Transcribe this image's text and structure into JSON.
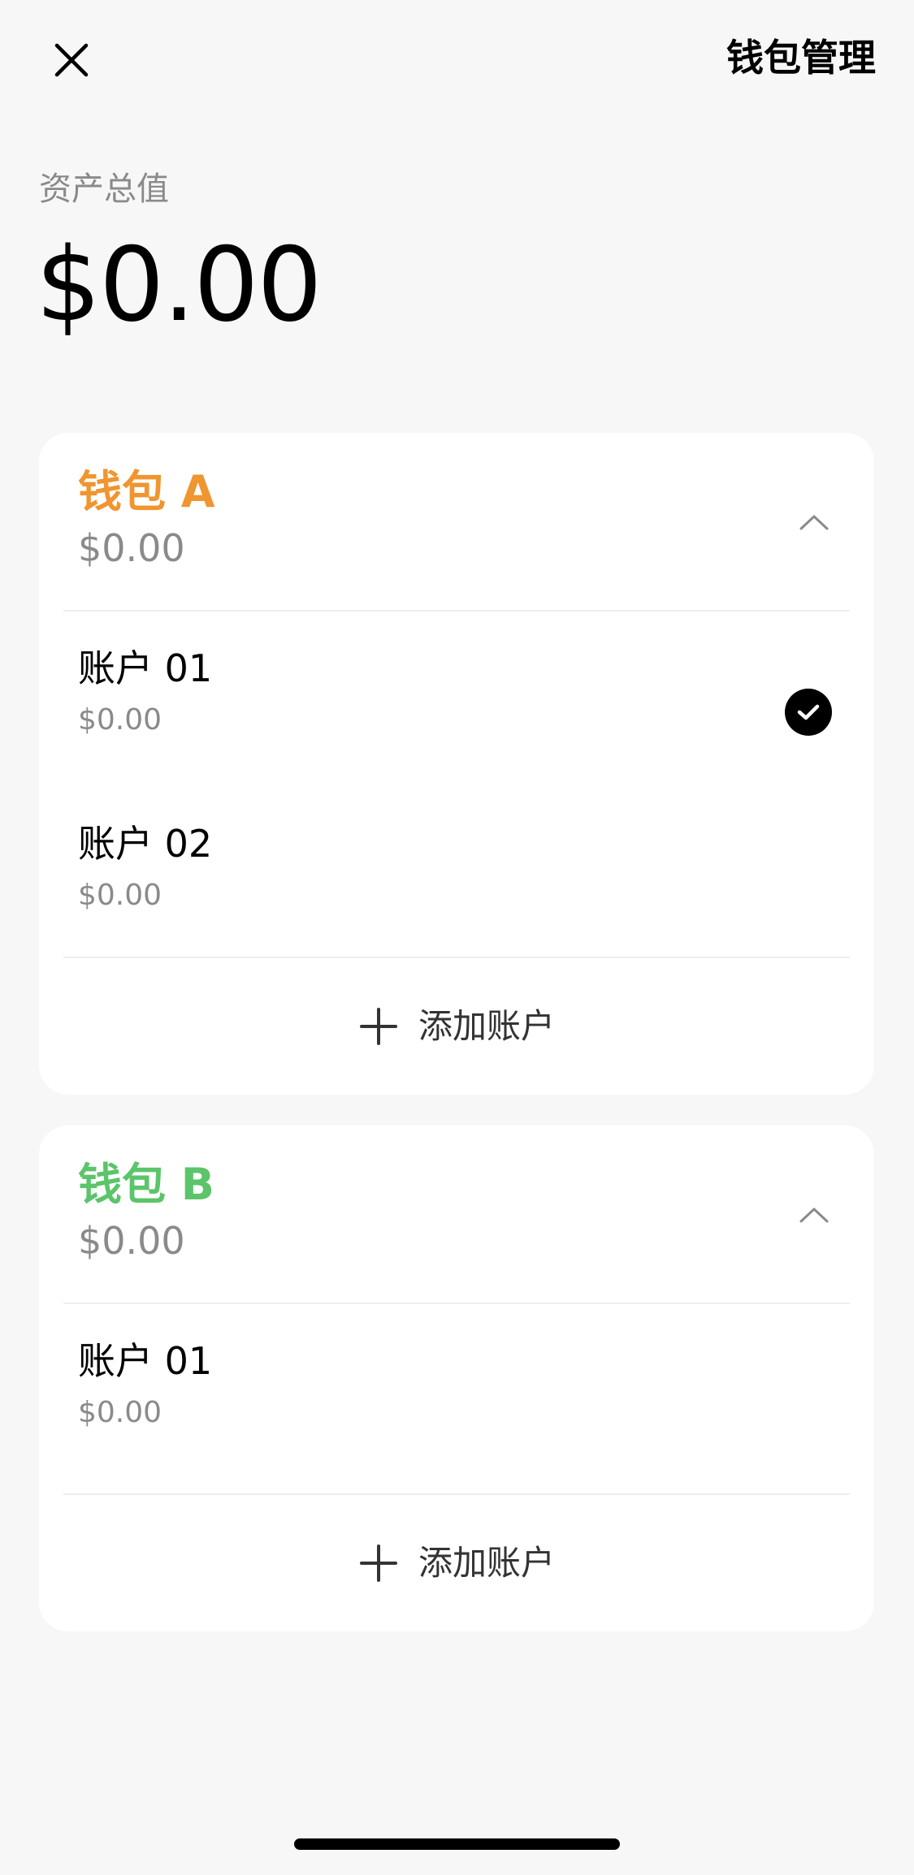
{
  "header": {
    "close_icon": "close-icon",
    "manage_label": "钱包管理"
  },
  "summary": {
    "label": "资产总值",
    "total": "$0.00"
  },
  "wallets": [
    {
      "name": "钱包 A",
      "color": "#f0952f",
      "balance": "$0.00",
      "expanded": true,
      "accounts": [
        {
          "name": "账户 01",
          "balance": "$0.00",
          "selected": true
        },
        {
          "name": "账户 02",
          "balance": "$0.00",
          "selected": false
        }
      ],
      "add_label": "添加账户"
    },
    {
      "name": "钱包 B",
      "color": "#5cc46a",
      "balance": "$0.00",
      "expanded": true,
      "accounts": [
        {
          "name": "账户 01",
          "balance": "$0.00",
          "selected": false
        }
      ],
      "add_label": "添加账户"
    }
  ]
}
